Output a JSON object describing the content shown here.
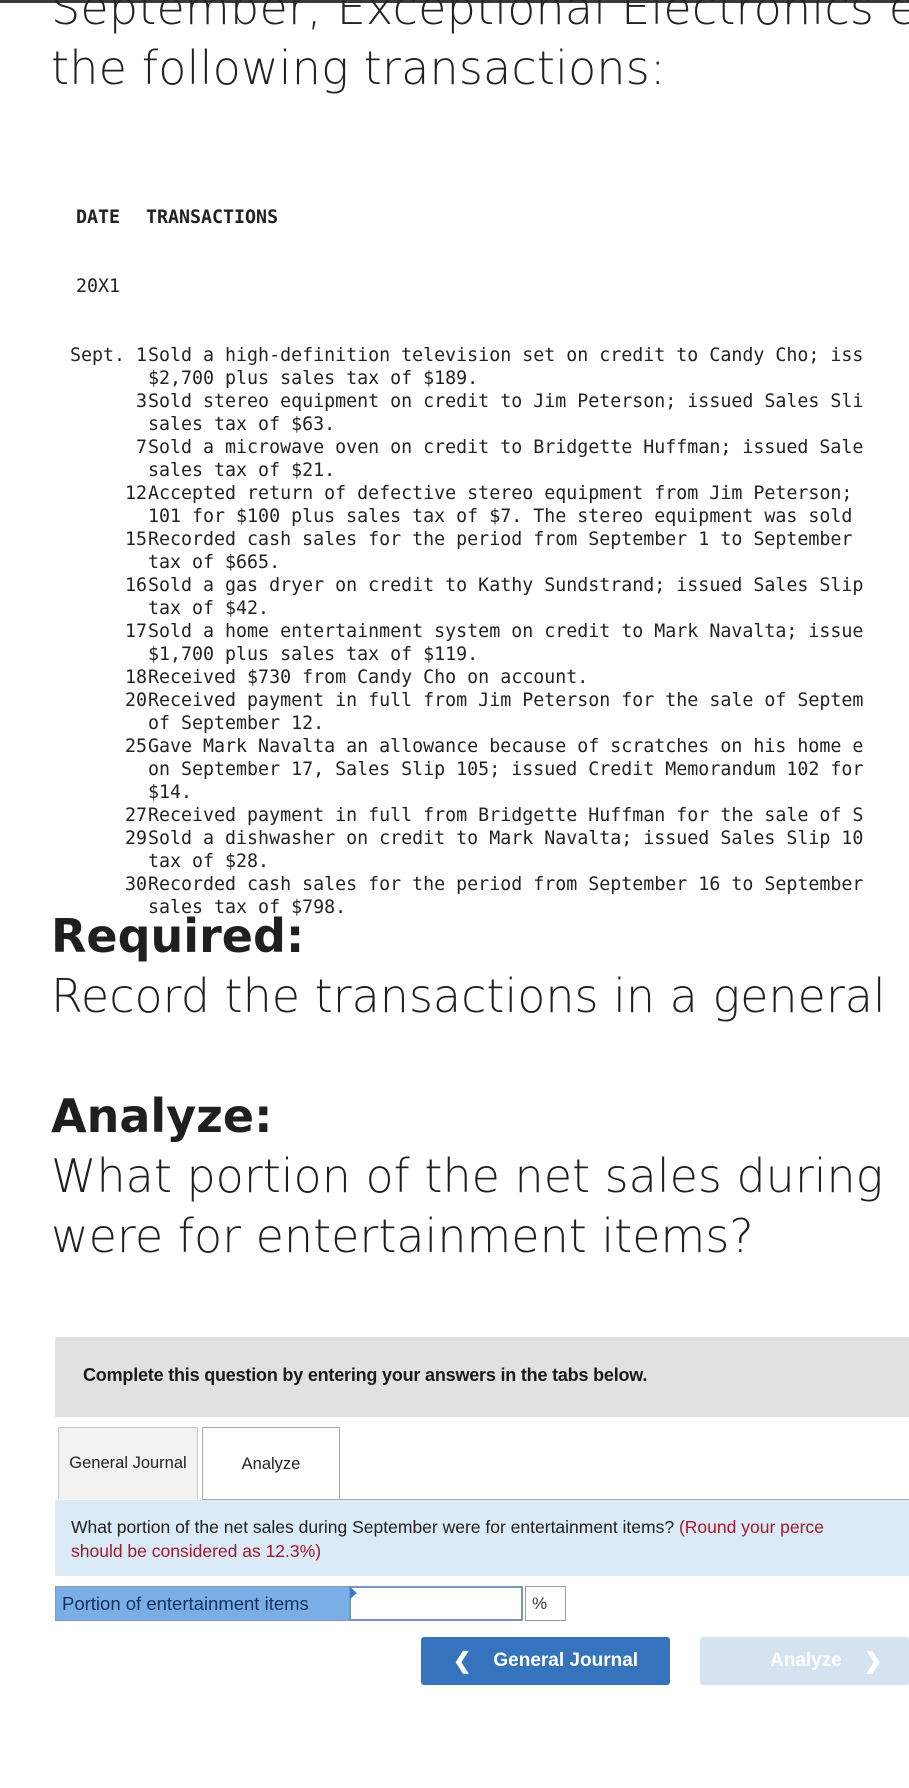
{
  "intro": {
    "lines": [
      "September, Exceptional Electronics e",
      "the following transactions:"
    ]
  },
  "transactions": {
    "header_date": "DATE",
    "header_transactions": "TRANSACTIONS",
    "year": "20X1",
    "rows": [
      {
        "date": "Sept. 1",
        "lines": [
          "Sold a high-definition television set on credit to Candy Cho; iss",
          "$2,700 plus sales tax of $189."
        ]
      },
      {
        "date": "3",
        "lines": [
          "Sold stereo equipment on credit to Jim Peterson; issued Sales Sli",
          "sales tax of $63."
        ]
      },
      {
        "date": "7",
        "lines": [
          "Sold a microwave oven on credit to Bridgette Huffman; issued Sale",
          "sales tax of $21."
        ]
      },
      {
        "date": "12",
        "lines": [
          "Accepted return of defective stereo equipment from Jim Peterson;",
          "101 for $100 plus sales tax of $7. The stereo equipment was sold"
        ]
      },
      {
        "date": "15",
        "lines": [
          "Recorded cash sales for the period from September 1 to September",
          "tax of $665."
        ]
      },
      {
        "date": "16",
        "lines": [
          "Sold a gas dryer on credit to Kathy Sundstrand; issued Sales Slip",
          "tax of $42."
        ]
      },
      {
        "date": "17",
        "lines": [
          "Sold a home entertainment system on credit to Mark Navalta; issue",
          "$1,700 plus sales tax of $119."
        ]
      },
      {
        "date": "18",
        "lines": [
          "Received $730 from Candy Cho on account."
        ]
      },
      {
        "date": "20",
        "lines": [
          "Received payment in full from Jim Peterson for the sale of Septem",
          "of September 12."
        ]
      },
      {
        "date": "25",
        "lines": [
          "Gave Mark Navalta an allowance because of scratches on his home e",
          "on September 17, Sales Slip 105; issued Credit Memorandum 102 for",
          "$14."
        ]
      },
      {
        "date": "27",
        "lines": [
          "Received payment in full from Bridgette Huffman for the sale of S"
        ]
      },
      {
        "date": "29",
        "lines": [
          "Sold a dishwasher on credit to Mark Navalta; issued Sales Slip 10",
          "tax of $28."
        ]
      },
      {
        "date": "30",
        "lines": [
          "Recorded cash sales for the period from September 16 to September",
          "sales tax of $798."
        ]
      }
    ]
  },
  "required": {
    "heading": "Required:",
    "text": "Record the transactions in a general"
  },
  "analyze": {
    "heading": "Analyze:",
    "lines": [
      "What portion of the net sales during",
      "were for entertainment items?"
    ]
  },
  "panel": {
    "instruction": "Complete this question by entering your answers in the tabs below.",
    "tabs": [
      {
        "label": "General Journal",
        "active": false
      },
      {
        "label": "Analyze",
        "active": true
      }
    ],
    "question": "What portion of the net sales during September were for entertainment items?",
    "question_note_line1": "(Round your perce",
    "question_note_line2": "should be considered as 12.3%)",
    "answer": {
      "label": "Portion of entertainment items",
      "value": "",
      "placeholder": "",
      "unit": "%"
    },
    "nav": {
      "prev_label": "General Journal",
      "next_label": "Analyze",
      "prev_icon": "chevron-left-icon",
      "next_icon": "chevron-right-icon",
      "next_disabled": true
    }
  },
  "colors": {
    "tab_active_bg": "#ffffff",
    "question_bg": "#daeaf7",
    "note_red": "#a3192a",
    "answer_label_bg": "#7aaee6",
    "prev_button": "#3574bd",
    "next_button_disabled": "#d5e2f0"
  }
}
